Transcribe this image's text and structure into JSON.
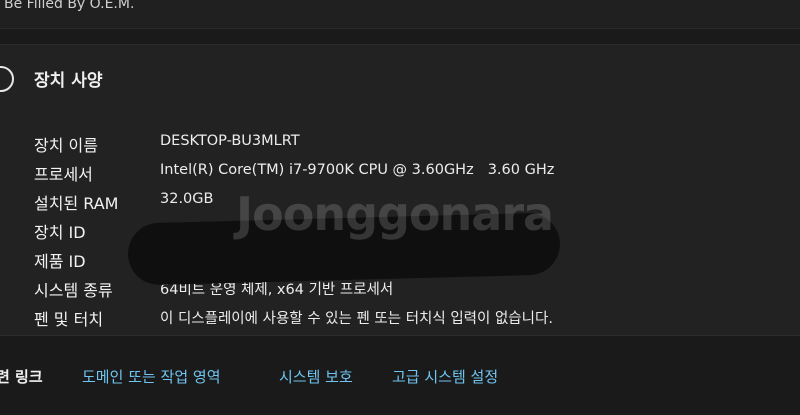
{
  "header": {
    "oem_text": "Be Filled By O.E.M."
  },
  "section": {
    "title": "장치 사양",
    "icon": "info-icon"
  },
  "specs": [
    {
      "label": "장치 이름",
      "value": "DESKTOP-BU3MLRT"
    },
    {
      "label": "프로세서",
      "value": "Intel(R) Core(TM) i7-9700K CPU @ 3.60GHz",
      "extra": "3.60 GHz"
    },
    {
      "label": "설치된 RAM",
      "value": "32.0GB"
    },
    {
      "label": "장치 ID",
      "value": ""
    },
    {
      "label": "제품 ID",
      "value": ""
    },
    {
      "label": "시스템 종류",
      "value": "64비트 운영 체제, x64 기반 프로세서"
    },
    {
      "label": "펜 및 터치",
      "value": "이 디스플레이에 사용할 수 있는 펜 또는 터치식 입력이 없습니다."
    }
  ],
  "watermark": "Joonggonara",
  "related": {
    "label": "련 링크",
    "links": [
      "도메인 또는 작업 영역",
      "시스템 보호",
      "고급 시스템 설정"
    ],
    "link_color": "#6fc4f0"
  }
}
